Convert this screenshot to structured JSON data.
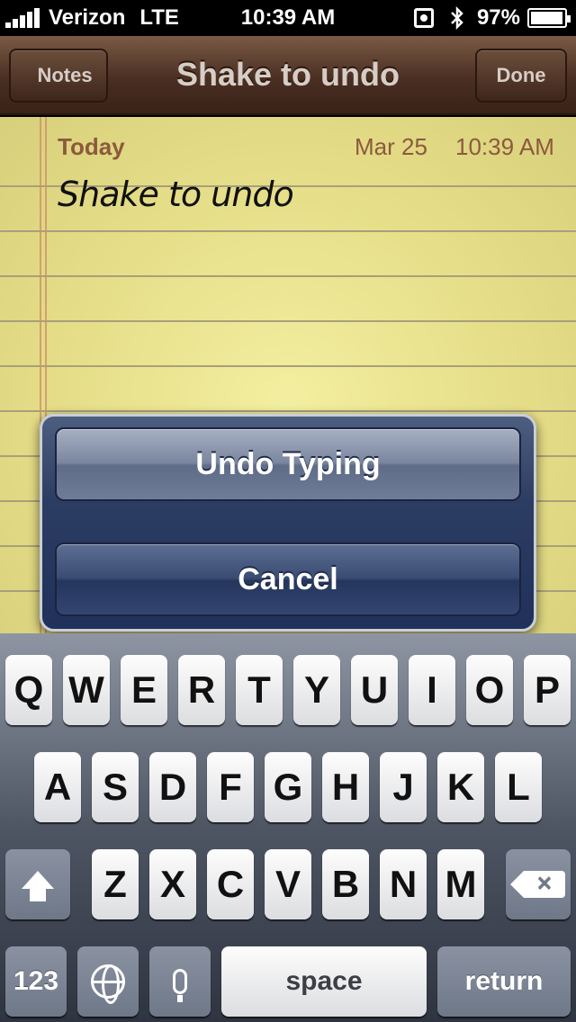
{
  "status_bar": {
    "carrier": "Verizon",
    "network": "LTE",
    "time": "10:39 AM",
    "battery": "97%"
  },
  "nav": {
    "back_label": "Notes",
    "title": "Shake to undo",
    "done_label": "Done"
  },
  "note": {
    "day": "Today",
    "date": "Mar 25",
    "time": "10:39 AM",
    "body": "Shake to undo"
  },
  "action_sheet": {
    "undo_label": "Undo Typing",
    "cancel_label": "Cancel"
  },
  "keyboard": {
    "row1": [
      "Q",
      "W",
      "E",
      "R",
      "T",
      "Y",
      "U",
      "I",
      "O",
      "P"
    ],
    "row2": [
      "A",
      "S",
      "D",
      "F",
      "G",
      "H",
      "J",
      "K",
      "L"
    ],
    "row3": [
      "Z",
      "X",
      "C",
      "V",
      "B",
      "N",
      "M"
    ],
    "numbers_label": "123",
    "space_label": "space",
    "return_label": "return"
  }
}
